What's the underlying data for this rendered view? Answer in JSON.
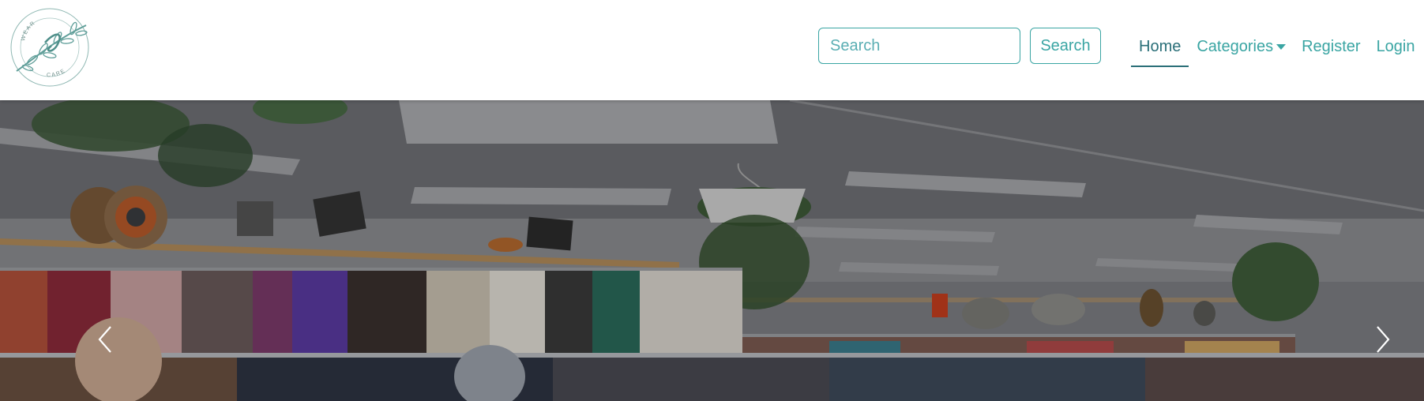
{
  "brand": {
    "logo_text_top": "WEAR",
    "logo_text_bottom": "CARE",
    "logo_color": "#5f9e99"
  },
  "search": {
    "placeholder": "Search",
    "button_label": "Search"
  },
  "nav": {
    "items": [
      {
        "label": "Home",
        "active": true
      },
      {
        "label": "Categories",
        "dropdown": true
      },
      {
        "label": "Register"
      },
      {
        "label": "Login"
      }
    ]
  },
  "hero": {
    "image": "thrift-store-clothing-racks",
    "prev_icon": "chevron-left-icon",
    "next_icon": "chevron-right-icon"
  },
  "colors": {
    "accent": "#3aa5a3",
    "active_nav": "#2a6f78"
  }
}
